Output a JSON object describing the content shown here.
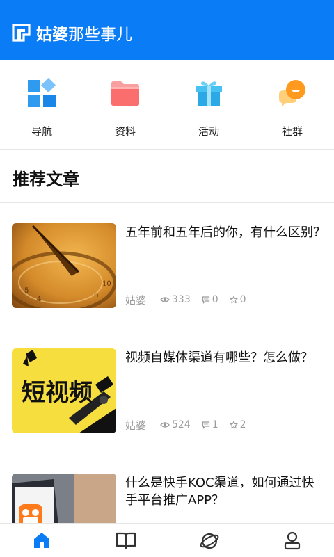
{
  "header": {
    "logo_bold": "姑婆",
    "logo_rest": "那些事儿",
    "color": "#0a7cf5"
  },
  "quick_nav": [
    {
      "label": "导航",
      "icon": "grid-blocks-icon"
    },
    {
      "label": "资料",
      "icon": "folder-icon"
    },
    {
      "label": "活动",
      "icon": "gift-icon"
    },
    {
      "label": "社群",
      "icon": "chat-bubbles-icon"
    }
  ],
  "section_title": "推荐文章",
  "articles": [
    {
      "title": "五年前和五年后的你，有什么区别？",
      "author": "姑婆",
      "views": "333",
      "comments": "0",
      "stars": "0",
      "thumb": "sundial-photo"
    },
    {
      "title": "视频自媒体渠道有哪些？怎么做？",
      "author": "姑婆",
      "views": "524",
      "comments": "1",
      "stars": "2",
      "thumb": "short-video-image",
      "thumb_text": "短视频"
    },
    {
      "title": "什么是快手KOC渠道，如何通过快手平台推广APP？",
      "thumb": "kuaishou-phone-photo"
    }
  ],
  "tabbar": [
    {
      "icon": "home-icon",
      "active": true
    },
    {
      "icon": "book-icon",
      "active": false
    },
    {
      "icon": "planet-icon",
      "active": false
    },
    {
      "icon": "user-icon",
      "active": false
    }
  ]
}
